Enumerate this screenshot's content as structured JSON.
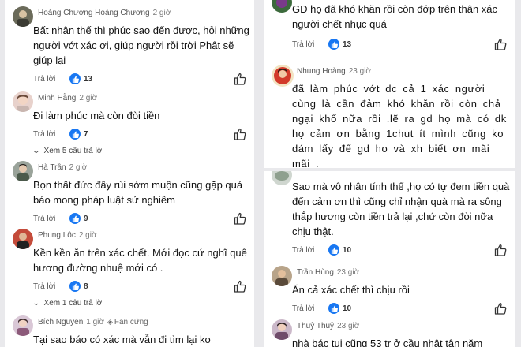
{
  "left": {
    "comments": [
      {
        "author": "Hoàng Chương Hoàng Chương",
        "time": "2 giờ",
        "text": "Bất nhân thế thì phúc sao đến được, hỏi những người vớt xác ơi, giúp người rồi trời Phật sẽ giúp lại",
        "reply_label": "Trả lời",
        "likes": "13"
      },
      {
        "author": "Minh Hằng",
        "time": "2 giờ",
        "text": "Đi làm phúc mà còn đòi tiền",
        "reply_label": "Trả lời",
        "likes": "7",
        "view_replies": "Xem 5 câu trả lời"
      },
      {
        "author": "Hà Trần",
        "time": "2 giờ",
        "text": "Bọn thất đức đấy rùi sớm muộn cũng gặp quả báo mong pháp luật sử nghiêm",
        "reply_label": "Trả lời",
        "likes": "9"
      },
      {
        "author": "Phung Lôc",
        "time": "2 giờ",
        "text": "Kền kền ăn trên xác chết. Mới đọc cứ nghĩ quê hương đường nhuệ mới có .",
        "reply_label": "Trả lời",
        "likes": "8",
        "view_replies": "Xem 1 câu trả lời"
      },
      {
        "author": "Bích Nguyen",
        "time": "1 giờ",
        "badge": "Fan cứng",
        "text": "Tại sao báo có xác mà vẫn đi tìm lại ko"
      }
    ]
  },
  "right_top": {
    "comments": [
      {
        "text": "GĐ họ đã khó khăn rồi còn đớp trên thân xác người chết nhục quá",
        "reply_label": "Trả lời",
        "likes": "13"
      },
      {
        "author": "Nhung Hoàng",
        "time": "23 giờ",
        "text": "đã làm phúc vớt dc cả 1 xác người cùng là cần đảm khó khăn rồi còn chả ngại khổ nữa rồi .lẽ ra gd họ mà có dk họ cảm ơn bằng 1chut ít mình cũng ko dám lấy để gd ho và xh biết ơn mãi mãi ."
      }
    ]
  },
  "right_bottom": {
    "comments": [
      {
        "text": "Sao mà vô nhân tính thế ,họ có tự đem tiền quà đến cảm ơn thì cũng chỉ nhận quà mà ra sông thắp hương còn tiền trả lại ,chứ còn đòi nữa chịu thật.",
        "reply_label": "Trả lời",
        "likes": "10"
      },
      {
        "author": "Trần Hùng",
        "time": "23 giờ",
        "text": "Ăn cả xác chết thì chịu rồi",
        "reply_label": "Trả lời",
        "likes": "10"
      },
      {
        "author": "Thuỷ Thuỷ",
        "time": "23 giờ",
        "text": "nhà bác tui cũng 53 tr ở cầu nhật tân năm"
      }
    ]
  },
  "colors": {
    "like_blue": "#1877f2",
    "panel_bg": "#ffffff",
    "page_bg": "#e9e9ec"
  },
  "icons": {
    "like_badge": "thumbs-up-badge-icon",
    "like_button": "thumbs-up-outline-icon",
    "expand": "chevron-down-icon",
    "fan": "diamond-icon"
  }
}
